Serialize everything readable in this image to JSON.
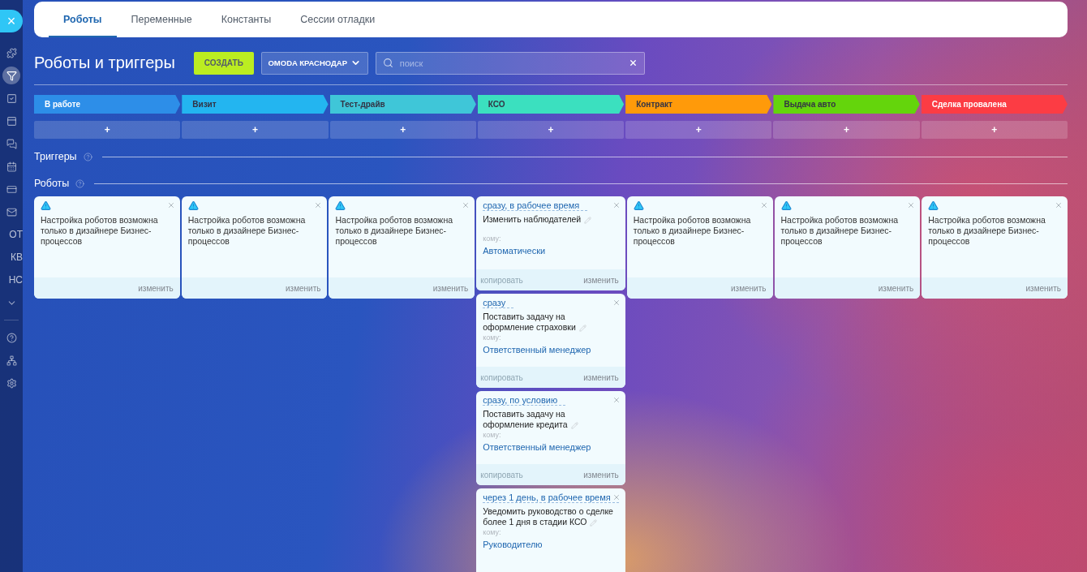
{
  "sidebar": {
    "close": "×",
    "items": [
      {
        "kind": "icon",
        "selected": false
      },
      {
        "kind": "icon",
        "selected": true
      },
      {
        "kind": "icon",
        "selected": false
      },
      {
        "kind": "icon",
        "selected": false
      },
      {
        "kind": "icon",
        "selected": false
      },
      {
        "kind": "icon",
        "selected": false
      },
      {
        "kind": "icon",
        "selected": false
      },
      {
        "kind": "icon",
        "selected": false
      },
      {
        "kind": "text",
        "label": "ОТ",
        "selected": false
      },
      {
        "kind": "text",
        "label": "КВ",
        "selected": false
      },
      {
        "kind": "text",
        "label": "НС",
        "selected": false
      },
      {
        "kind": "icon",
        "selected": false
      },
      {
        "kind": "divider"
      },
      {
        "kind": "icon",
        "selected": false
      },
      {
        "kind": "icon",
        "selected": false
      },
      {
        "kind": "icon",
        "selected": false
      }
    ]
  },
  "tabs": [
    {
      "label": "Роботы",
      "selected": true
    },
    {
      "label": "Переменные",
      "selected": false
    },
    {
      "label": "Константы",
      "selected": false
    },
    {
      "label": "Сессии отладки",
      "selected": false
    }
  ],
  "header": {
    "title": "Роботы и триггеры",
    "create_button": "СОЗДАТЬ",
    "dropdown": "OMODA КРАСНОДАР",
    "search": {
      "placeholder": "поиск"
    }
  },
  "stages": [
    {
      "name": "В работе",
      "color": "#2d8ee8"
    },
    {
      "name": "Визит",
      "color": "#23b5f0"
    },
    {
      "name": "Тест-драйв",
      "color": "#3fc6d8"
    },
    {
      "name": "КСО",
      "color": "#3be0bf"
    },
    {
      "name": "Контракт",
      "color": "#ff9a0a"
    },
    {
      "name": "Выдача авто",
      "color": "#64d50c"
    },
    {
      "name": "Сделка провалена",
      "color": "#fc3c44"
    }
  ],
  "add_label": "+",
  "sections": [
    {
      "title": "Триггеры"
    },
    {
      "title": "Роботы"
    }
  ],
  "columns": [
    {
      "robots": [
        {
          "kind": "warning",
          "text": "Настройка роботов возможна только в дизайнере Бизнес-процессов",
          "edit": "изменить"
        }
      ]
    },
    {
      "robots": [
        {
          "kind": "warning",
          "text": "Настройка роботов возможна только в дизайнере Бизнес-процессов",
          "edit": "изменить"
        }
      ]
    },
    {
      "robots": [
        {
          "kind": "warning",
          "text": "Настройка роботов возможна только в дизайнере Бизнес-процессов",
          "edit": "изменить"
        }
      ]
    },
    {
      "robots": [
        {
          "kind": "action",
          "condition": "сразу, в рабочее время",
          "title": "Изменить наблюдателей",
          "to_label": "кому:",
          "to_value": "Автоматически",
          "copy": "копировать",
          "edit": "изменить"
        },
        {
          "kind": "action",
          "condition": "сразу",
          "title": "Поставить задачу на оформление страховки",
          "to_label": "кому:",
          "to_value": "Ответственный менеджер",
          "copy": "копировать",
          "edit": "изменить"
        },
        {
          "kind": "action",
          "condition": "сразу, по условию",
          "title": "Поставить задачу на оформление кредита",
          "to_label": "кому:",
          "to_value": "Ответственный менеджер",
          "copy": "копировать",
          "edit": "изменить"
        },
        {
          "kind": "action",
          "condition": "через 1 день, в рабочее время",
          "title": "Уведомить руководство о сделке более 1 дня в стадии КСО",
          "to_label": "кому:",
          "to_value": "Руководителю"
        }
      ]
    },
    {
      "robots": [
        {
          "kind": "warning",
          "text": "Настройка роботов возможна только в дизайнере Бизнес-процессов",
          "edit": "изменить"
        }
      ]
    },
    {
      "robots": [
        {
          "kind": "warning",
          "text": "Настройка роботов возможна только в дизайнере Бизнес-процессов",
          "edit": "изменить"
        }
      ]
    },
    {
      "robots": [
        {
          "kind": "warning",
          "text": "Настройка роботов возможна только в дизайнере Бизнес-процессов",
          "edit": "изменить"
        }
      ]
    }
  ]
}
